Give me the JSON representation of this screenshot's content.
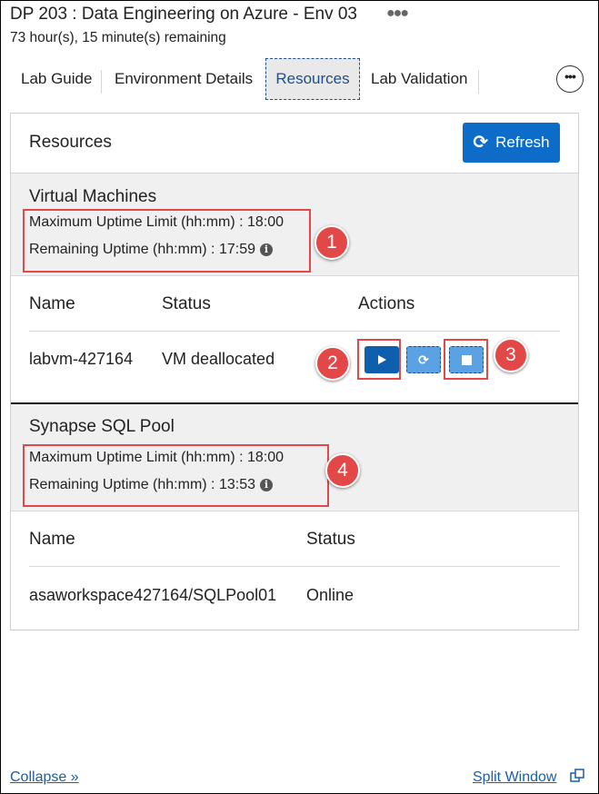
{
  "header": {
    "title": "DP 203 : Data Engineering on Azure - Env 03",
    "time_remaining": "73 hour(s), 15 minute(s) remaining"
  },
  "tabs": [
    {
      "label": "Lab Guide"
    },
    {
      "label": "Environment Details"
    },
    {
      "label": "Resources",
      "active": true
    },
    {
      "label": "Lab Validation"
    }
  ],
  "resources": {
    "title": "Resources",
    "refresh_label": "Refresh",
    "virtual_machines": {
      "title": "Virtual Machines",
      "max_uptime": "Maximum Uptime Limit (hh:mm) : 18:00",
      "remaining_uptime": "Remaining Uptime (hh:mm) : 17:59",
      "columns": [
        "Name",
        "Status",
        "Actions"
      ],
      "rows": [
        {
          "name": "labvm-427164",
          "status": "VM deallocated"
        }
      ]
    },
    "sql_pool": {
      "title": "Synapse SQL Pool",
      "max_uptime": "Maximum Uptime Limit (hh:mm) : 18:00",
      "remaining_uptime": "Remaining Uptime (hh:mm) : 13:53",
      "columns": [
        "Name",
        "Status"
      ],
      "rows": [
        {
          "name": "asaworkspace427164/SQLPool01",
          "status": "Online"
        }
      ]
    }
  },
  "callouts": [
    "1",
    "2",
    "3",
    "4"
  ],
  "footer": {
    "collapse": "Collapse »",
    "split_window": "Split Window"
  },
  "colors": {
    "accent": "#0e6cc9",
    "callout": "#e34848",
    "active_tab_border": "#1f4e8c"
  },
  "icons": {
    "more": "more-horizontal-icon",
    "refresh": "refresh-icon",
    "info": "info-icon",
    "start": "play-icon",
    "restart": "restart-icon",
    "stop": "stop-icon",
    "split": "split-window-icon"
  }
}
